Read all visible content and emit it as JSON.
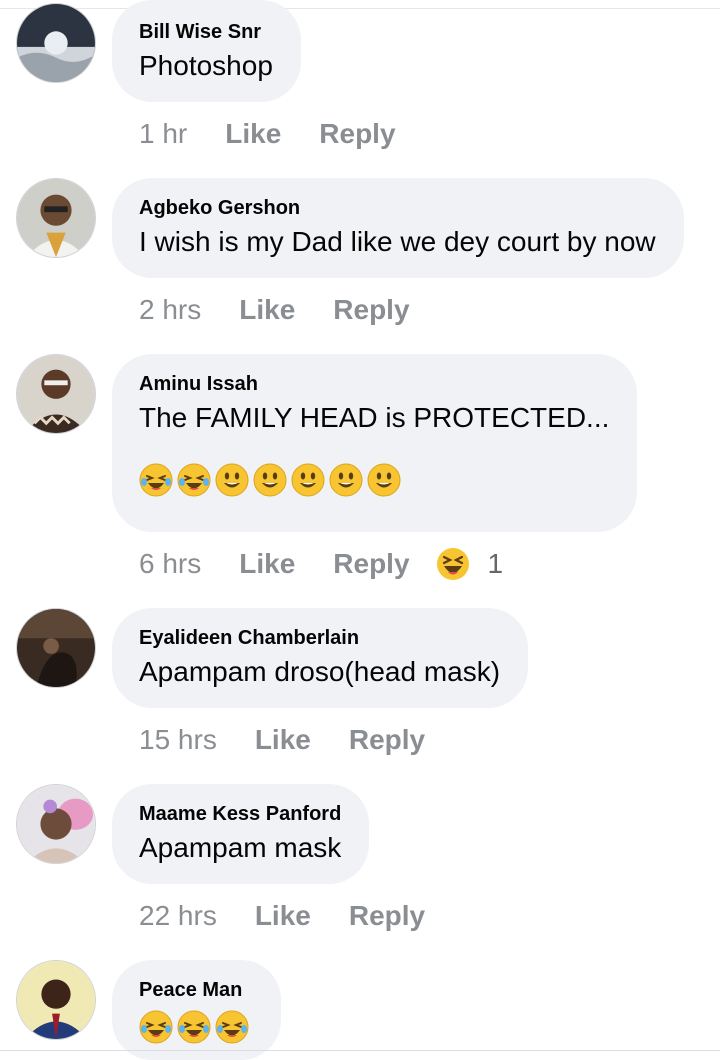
{
  "comments": [
    {
      "author": "Bill Wise Snr",
      "text": "Photoshop",
      "time": "1 hr",
      "like_label": "Like",
      "reply_label": "Reply"
    },
    {
      "author": "Agbeko Gershon",
      "text": "I wish is my Dad like we dey court by now",
      "time": "2 hrs",
      "like_label": "Like",
      "reply_label": "Reply"
    },
    {
      "author": "Aminu Issah",
      "text": "The FAMILY HEAD is PROTECTED...",
      "emojis": [
        "laughing-tears",
        "laughing-tears",
        "smiley",
        "smiley",
        "smiley",
        "smiley",
        "smiley"
      ],
      "time": "6 hrs",
      "like_label": "Like",
      "reply_label": "Reply",
      "reaction": {
        "icon": "haha-reaction",
        "count": "1"
      }
    },
    {
      "author": "Eyalideen Chamberlain",
      "text": "Apampam droso(head mask)",
      "time": "15 hrs",
      "like_label": "Like",
      "reply_label": "Reply"
    },
    {
      "author": "Maame Kess Panford",
      "text": "Apampam mask",
      "time": "22 hrs",
      "like_label": "Like",
      "reply_label": "Reply"
    },
    {
      "author": "Peace Man",
      "emojis": [
        "laughing-tears",
        "laughing-tears",
        "laughing-tears"
      ]
    }
  ],
  "colors": {
    "bubble": "#f0f2f5",
    "meta_text": "#8a8d91",
    "name_text": "#050505",
    "emoji_yellow": "#f7c531"
  }
}
